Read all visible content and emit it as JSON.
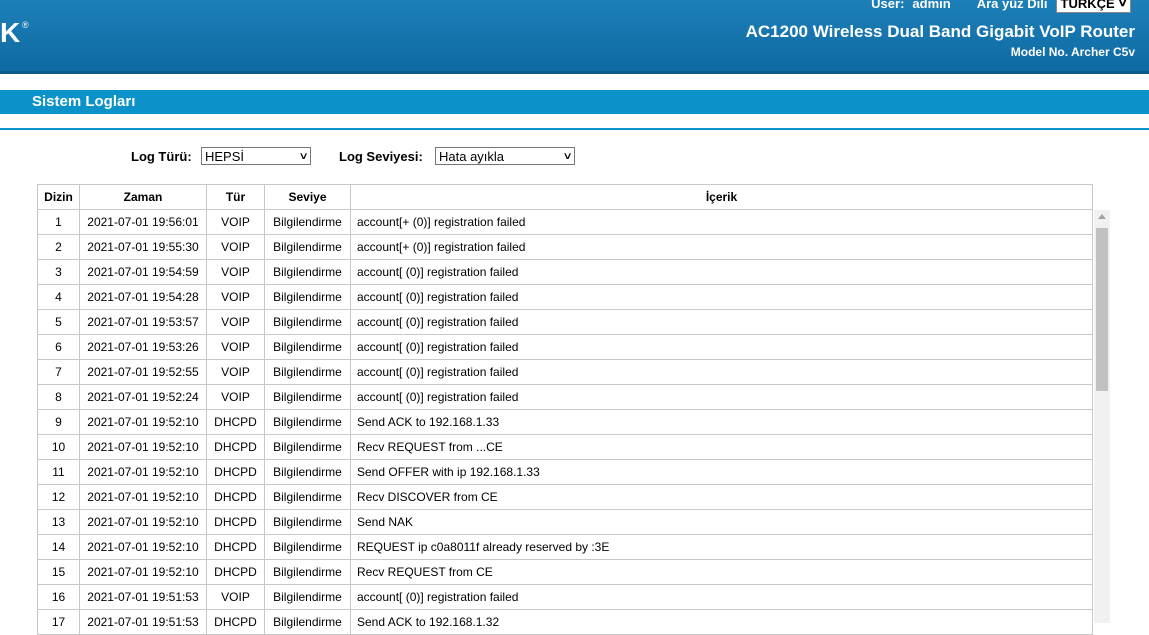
{
  "header": {
    "logo_text": "K",
    "user_label": "User:",
    "user_name": "admin",
    "lang_label": "Ara yüz Dili",
    "lang_value": "TÜRKÇE",
    "product_title": "AC1200 Wireless Dual Band Gigabit VoIP Router",
    "model_no": "Model No. Archer C5v"
  },
  "page": {
    "title": "Sistem Logları"
  },
  "filters": {
    "log_type_label": "Log Türü:",
    "log_type_value": "HEPSİ",
    "log_level_label": "Log Seviyesi:",
    "log_level_value": "Hata ayıkla"
  },
  "table": {
    "headers": [
      "Dizin",
      "Zaman",
      "Tür",
      "Seviye",
      "İçerik"
    ],
    "rows": [
      {
        "index": "1",
        "time": "2021-07-01 19:56:01",
        "type": "VOIP",
        "level": "Bilgilendirme",
        "content": "account[+ (0)] registration failed"
      },
      {
        "index": "2",
        "time": "2021-07-01 19:55:30",
        "type": "VOIP",
        "level": "Bilgilendirme",
        "content": "account[+ (0)] registration failed"
      },
      {
        "index": "3",
        "time": "2021-07-01 19:54:59",
        "type": "VOIP",
        "level": "Bilgilendirme",
        "content": "account[ (0)] registration failed"
      },
      {
        "index": "4",
        "time": "2021-07-01 19:54:28",
        "type": "VOIP",
        "level": "Bilgilendirme",
        "content": "account[ (0)] registration failed"
      },
      {
        "index": "5",
        "time": "2021-07-01 19:53:57",
        "type": "VOIP",
        "level": "Bilgilendirme",
        "content": "account[ (0)] registration failed"
      },
      {
        "index": "6",
        "time": "2021-07-01 19:53:26",
        "type": "VOIP",
        "level": "Bilgilendirme",
        "content": "account[ (0)] registration failed"
      },
      {
        "index": "7",
        "time": "2021-07-01 19:52:55",
        "type": "VOIP",
        "level": "Bilgilendirme",
        "content": "account[ (0)] registration failed"
      },
      {
        "index": "8",
        "time": "2021-07-01 19:52:24",
        "type": "VOIP",
        "level": "Bilgilendirme",
        "content": "account[ (0)] registration failed"
      },
      {
        "index": "9",
        "time": "2021-07-01 19:52:10",
        "type": "DHCPD",
        "level": "Bilgilendirme",
        "content": "Send ACK to 192.168.1.33"
      },
      {
        "index": "10",
        "time": "2021-07-01 19:52:10",
        "type": "DHCPD",
        "level": "Bilgilendirme",
        "content": "Recv REQUEST from ...CE"
      },
      {
        "index": "11",
        "time": "2021-07-01 19:52:10",
        "type": "DHCPD",
        "level": "Bilgilendirme",
        "content": "Send OFFER with ip 192.168.1.33"
      },
      {
        "index": "12",
        "time": "2021-07-01 19:52:10",
        "type": "DHCPD",
        "level": "Bilgilendirme",
        "content": "Recv DISCOVER from CE"
      },
      {
        "index": "13",
        "time": "2021-07-01 19:52:10",
        "type": "DHCPD",
        "level": "Bilgilendirme",
        "content": "Send NAK"
      },
      {
        "index": "14",
        "time": "2021-07-01 19:52:10",
        "type": "DHCPD",
        "level": "Bilgilendirme",
        "content": "REQUEST ip c0a8011f already reserved by :3E"
      },
      {
        "index": "15",
        "time": "2021-07-01 19:52:10",
        "type": "DHCPD",
        "level": "Bilgilendirme",
        "content": "Recv REQUEST from CE"
      },
      {
        "index": "16",
        "time": "2021-07-01 19:51:53",
        "type": "VOIP",
        "level": "Bilgilendirme",
        "content": "account[ (0)] registration failed"
      },
      {
        "index": "17",
        "time": "2021-07-01 19:51:53",
        "type": "DHCPD",
        "level": "Bilgilendirme",
        "content": "Send ACK to 192.168.1.32"
      }
    ]
  },
  "colors": {
    "header_bg": "#1670a8",
    "title_bar_bg": "#0b93c9",
    "table_border": "#c8c8c8"
  }
}
